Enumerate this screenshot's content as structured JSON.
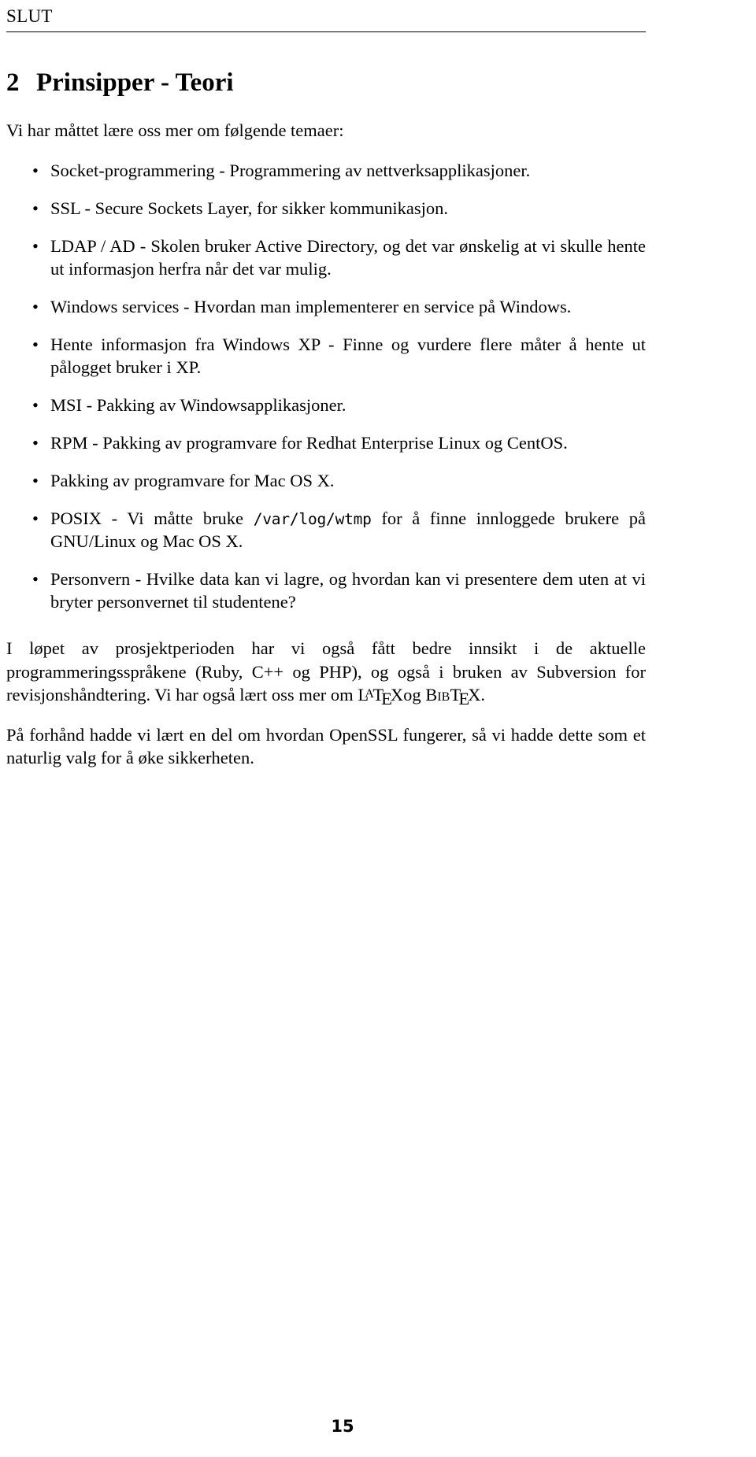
{
  "document": {
    "running_header": "SLUT",
    "page_number": "15",
    "language": "Norwegian"
  },
  "section": {
    "number": "2",
    "title": "Prinsipper - Teori"
  },
  "lead_text": "Vi har måttet lære oss mer om følgende temaer:",
  "bullets": [
    {
      "marker": "•",
      "text": "Socket-programmering - Programmering av nettverksapplikasjoner."
    },
    {
      "marker": "•",
      "text": "SSL - Secure Sockets Layer, for sikker kommunikasjon."
    },
    {
      "marker": "•",
      "text": "LDAP / AD - Skolen bruker Active Directory, og det var ønskelig at vi skulle hente ut informasjon herfra når det var mulig."
    },
    {
      "marker": "•",
      "text": "Windows services - Hvordan man implementerer en service på Windows."
    },
    {
      "marker": "•",
      "text": "Hente informasjon fra Windows XP - Finne og vurdere flere måter å hente ut pålogget bruker i XP."
    },
    {
      "marker": "•",
      "text": "MSI - Pakking av Windowsapplikasjoner."
    },
    {
      "marker": "•",
      "text": "RPM - Pakking av programvare for Redhat Enterprise Linux og CentOS."
    },
    {
      "marker": "•",
      "text": "Pakking av programvare for Mac OS X."
    },
    {
      "marker": "•",
      "text_before_code": "POSIX - Vi måtte bruke ",
      "code": "/var/log/wtmp",
      "text_after_code": " for å finne innloggede brukere på GNU/Linux og Mac OS X."
    },
    {
      "marker": "•",
      "text": "Personvern - Hvilke data kan vi lagre, og hvordan kan vi presentere dem uten at vi bryter personvernet til studentene?"
    }
  ],
  "paragraphs": {
    "first": {
      "text_before_logos": "I løpet av prosjektperioden har vi også fått bedre innsikt i de aktuelle programmeringsspråkene (Ruby, C++ og PHP), og også i bruken av Subversion for revisjonshåndtering. Vi har også lært oss mer om ",
      "latex_logo": {
        "l": "L",
        "a": "A",
        "t": "T",
        "e": "E",
        "x": "X"
      },
      "between_logos": "og ",
      "bibtex_logo": {
        "bib": "Bib",
        "t": "T",
        "e": "E",
        "x": "X"
      },
      "text_after_logos": "."
    },
    "second": {
      "text": "På forhånd hadde vi lært en del om hvordan OpenSSL fungerer, så vi hadde dette som et naturlig valg for å øke sikkerheten."
    }
  }
}
